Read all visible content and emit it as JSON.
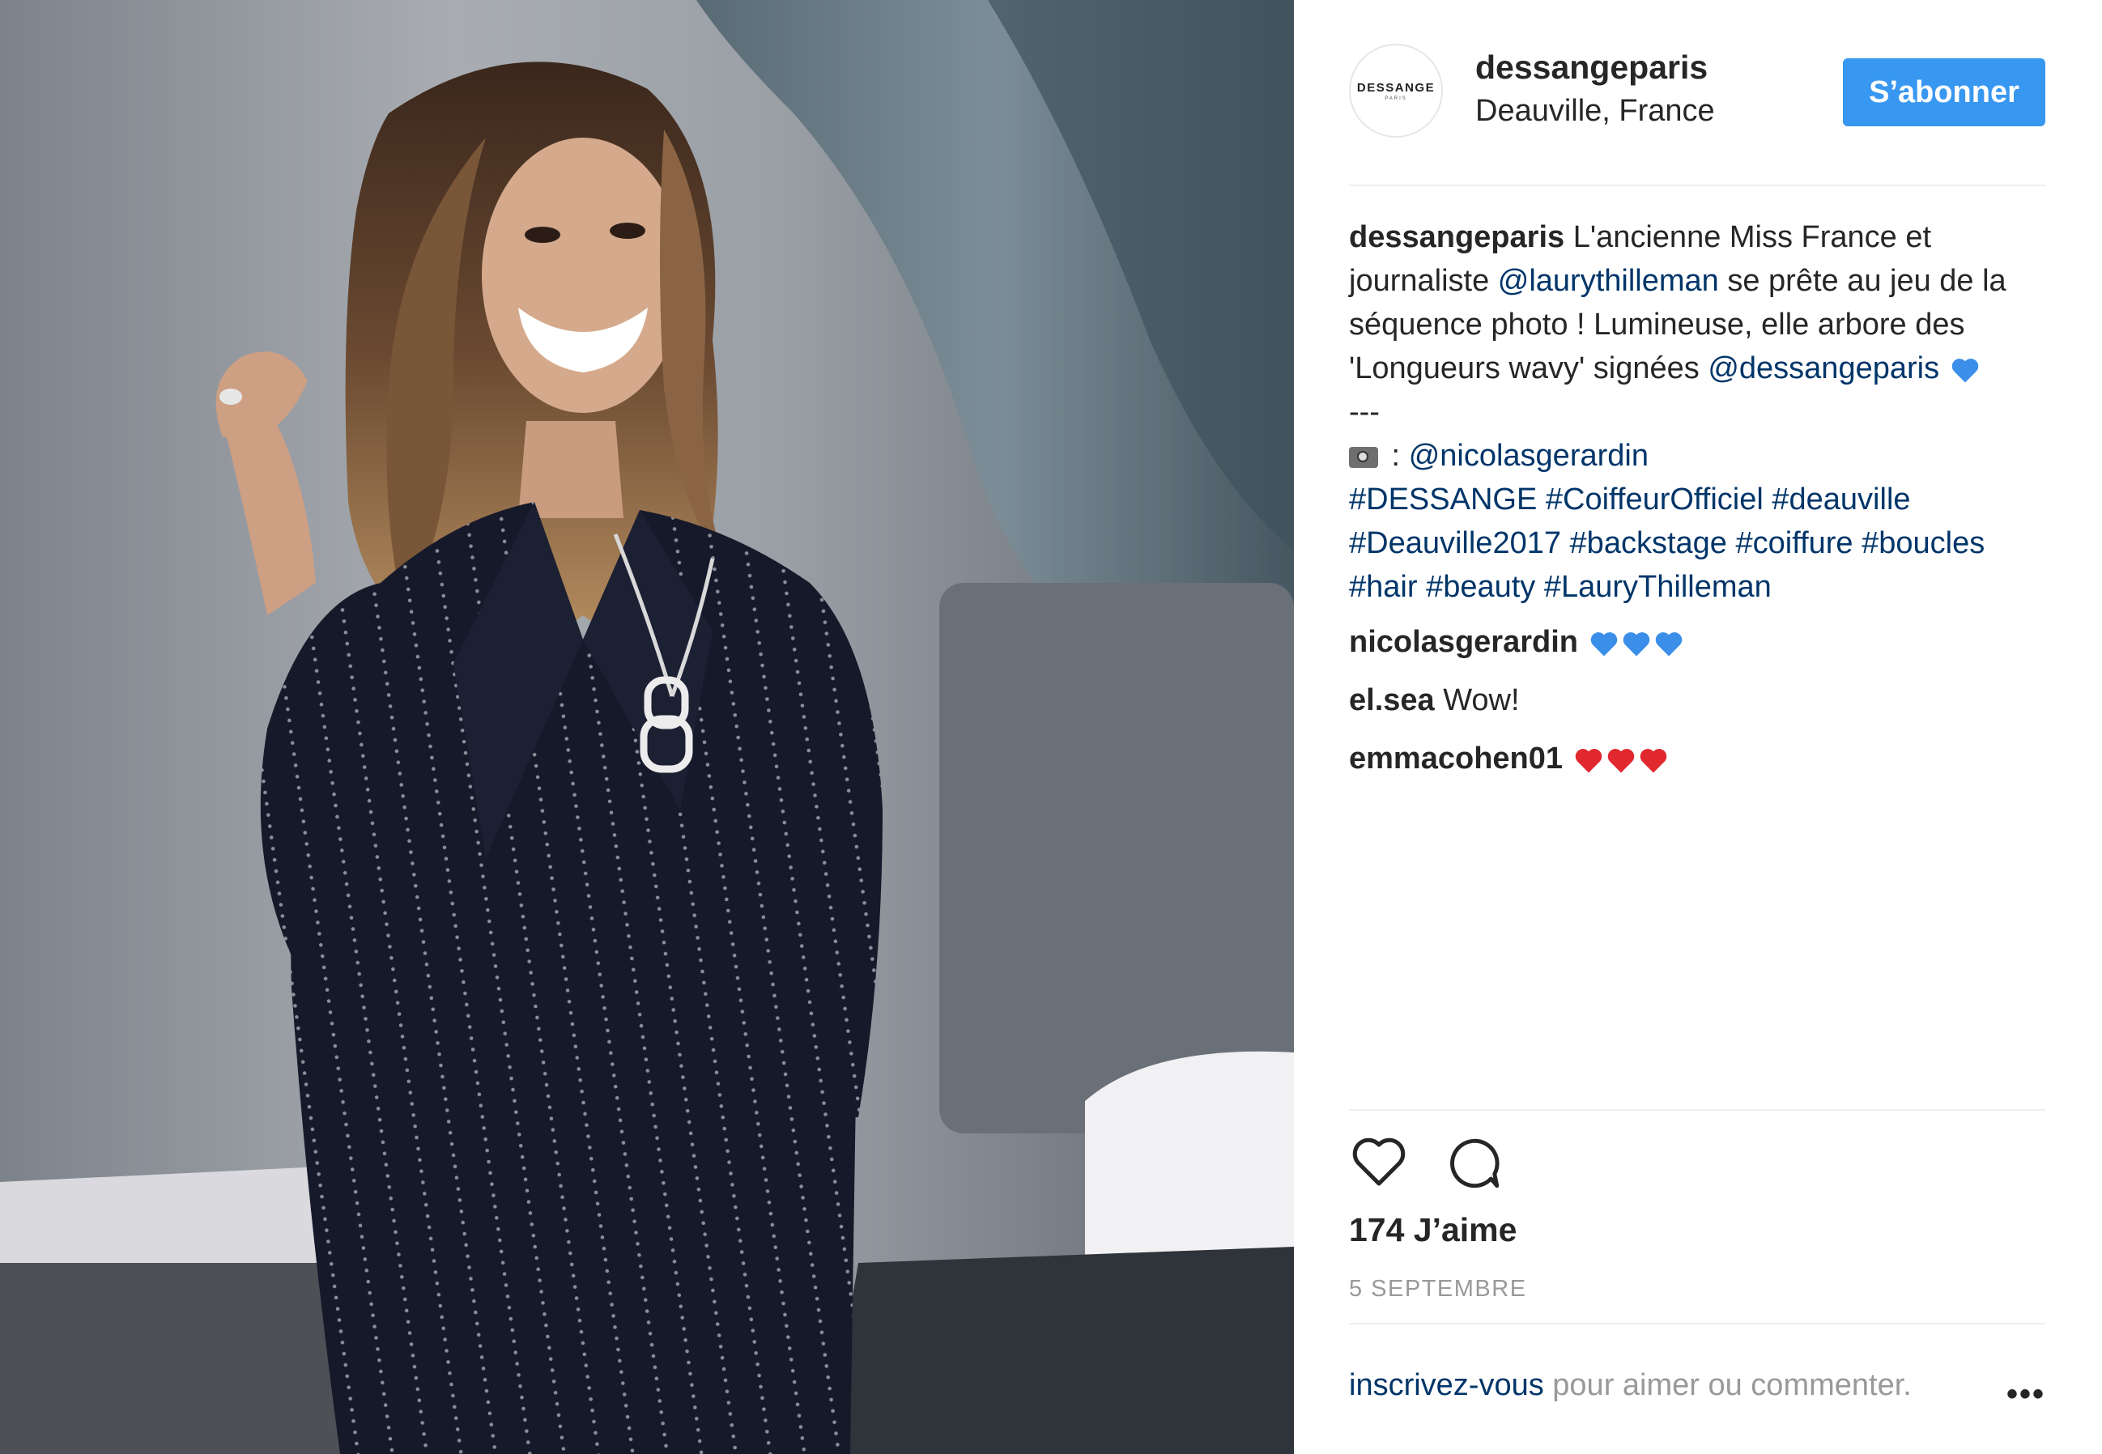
{
  "header": {
    "username": "dessangeparis",
    "location": "Deauville, France",
    "follow_label": "S’abonner",
    "avatar_logo": "DESSANGE",
    "avatar_logo_sub": "PARIS"
  },
  "caption": {
    "user": "dessangeparis",
    "text1": " L'ancienne Miss France et journaliste ",
    "mention1": "@laurythilleman",
    "text2": " se prête au jeu de la séquence photo ! Lumineuse, elle arbore des 'Longueurs wavy' signées ",
    "mention2": "@dessangeparis",
    "separator": "---",
    "photo_credit_prefix": " : ",
    "mention3": "@nicolasgerardin",
    "hashtags": [
      "#DESSANGE",
      "#CoiffeurOfficiel",
      "#deauville",
      "#Deauville2017",
      "#backstage",
      "#coiffure",
      "#boucles",
      "#hair",
      "#beauty",
      "#LauryThilleman"
    ]
  },
  "comments": [
    {
      "user": "nicolasgerardin",
      "text": "",
      "hearts": "blue",
      "count": 3
    },
    {
      "user": "el.sea",
      "text": "Wow!",
      "hearts": "",
      "count": 0
    },
    {
      "user": "emmacohen01",
      "text": "",
      "hearts": "red",
      "count": 3
    }
  ],
  "icons": {
    "like": "heart-outline-icon",
    "comment": "speech-bubble-icon",
    "more": "ellipsis-icon",
    "photo": "camera-emoji-icon"
  },
  "colors": {
    "follow_button": "#3897f0",
    "link": "#003569",
    "blue_heart": "#3b8fe8",
    "red_heart": "#e0282e"
  },
  "likes": "174 J’aime",
  "date": "5 SEPTEMBRE",
  "footer": {
    "login_link": "inscrivez-vous",
    "login_text": " pour aimer ou commenter.",
    "more_label": "•••"
  }
}
